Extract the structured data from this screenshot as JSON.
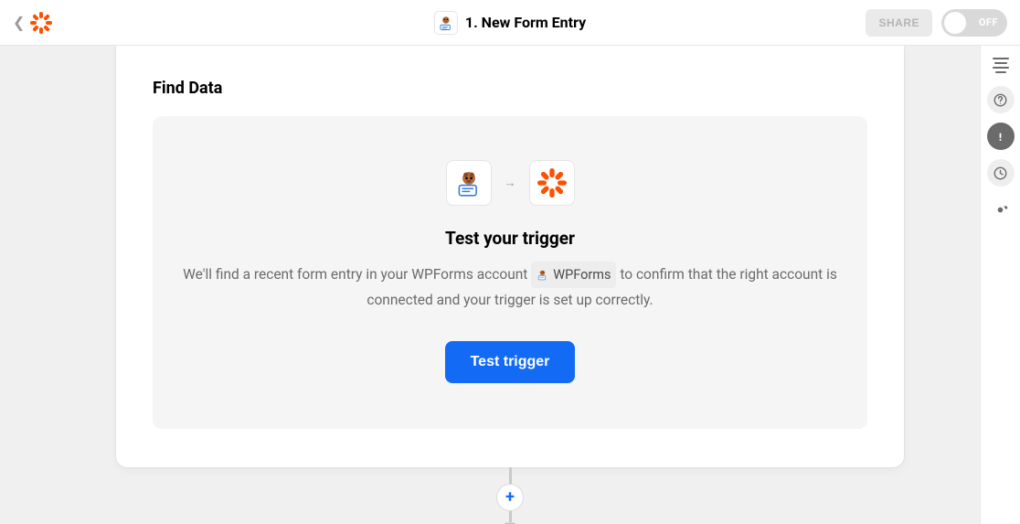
{
  "header": {
    "title": "1. New Form Entry",
    "share_label": "SHARE",
    "toggle_label": "OFF"
  },
  "section": {
    "title": "Find Data",
    "test_heading": "Test your trigger",
    "desc_part1": "We'll find a recent form entry in your WPForms account ",
    "desc_part2": " to confirm that the right account is connected and your trigger is set up correctly.",
    "chip_label": "WPForms",
    "test_button": "Test trigger"
  },
  "add_glyph": "+",
  "arrow_glyph": "→"
}
